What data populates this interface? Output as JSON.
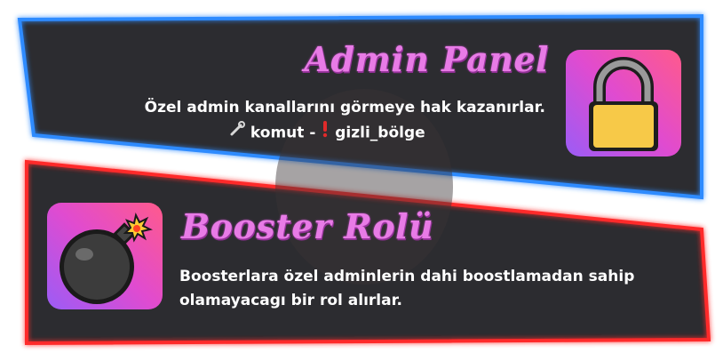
{
  "cards": [
    {
      "title": "Admin Panel",
      "description": "Özel admin kanallarını görmeye hak kazanırlar.",
      "command_label": "komut",
      "command_separator": "-",
      "command_value": "gizli_bölge",
      "icon": "lock-icon",
      "border_color": "#2f8bff"
    },
    {
      "title": "Booster Rolü",
      "description_line1": "Boosterlara özel  adminlerin dahi boostlamadan sahip",
      "description_line2": "olamayacagı bir rol alırlar.",
      "icon": "bomb-icon",
      "border_color": "#ff2a2a"
    }
  ],
  "colors": {
    "panel_bg": "#2c2c30",
    "title": "#e87be6",
    "text": "#ffffff"
  }
}
